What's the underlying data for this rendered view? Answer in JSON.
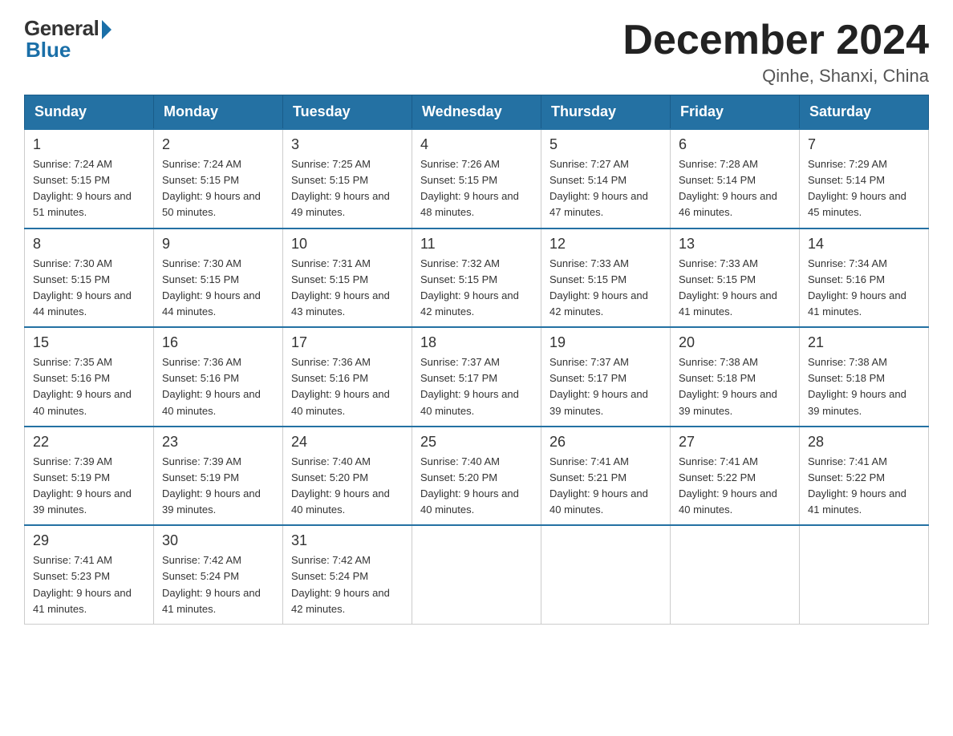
{
  "logo": {
    "general": "General",
    "blue": "Blue"
  },
  "title": "December 2024",
  "location": "Qinhe, Shanxi, China",
  "days_of_week": [
    "Sunday",
    "Monday",
    "Tuesday",
    "Wednesday",
    "Thursday",
    "Friday",
    "Saturday"
  ],
  "weeks": [
    [
      {
        "day": "1",
        "sunrise": "7:24 AM",
        "sunset": "5:15 PM",
        "daylight": "9 hours and 51 minutes."
      },
      {
        "day": "2",
        "sunrise": "7:24 AM",
        "sunset": "5:15 PM",
        "daylight": "9 hours and 50 minutes."
      },
      {
        "day": "3",
        "sunrise": "7:25 AM",
        "sunset": "5:15 PM",
        "daylight": "9 hours and 49 minutes."
      },
      {
        "day": "4",
        "sunrise": "7:26 AM",
        "sunset": "5:15 PM",
        "daylight": "9 hours and 48 minutes."
      },
      {
        "day": "5",
        "sunrise": "7:27 AM",
        "sunset": "5:14 PM",
        "daylight": "9 hours and 47 minutes."
      },
      {
        "day": "6",
        "sunrise": "7:28 AM",
        "sunset": "5:14 PM",
        "daylight": "9 hours and 46 minutes."
      },
      {
        "day": "7",
        "sunrise": "7:29 AM",
        "sunset": "5:14 PM",
        "daylight": "9 hours and 45 minutes."
      }
    ],
    [
      {
        "day": "8",
        "sunrise": "7:30 AM",
        "sunset": "5:15 PM",
        "daylight": "9 hours and 44 minutes."
      },
      {
        "day": "9",
        "sunrise": "7:30 AM",
        "sunset": "5:15 PM",
        "daylight": "9 hours and 44 minutes."
      },
      {
        "day": "10",
        "sunrise": "7:31 AM",
        "sunset": "5:15 PM",
        "daylight": "9 hours and 43 minutes."
      },
      {
        "day": "11",
        "sunrise": "7:32 AM",
        "sunset": "5:15 PM",
        "daylight": "9 hours and 42 minutes."
      },
      {
        "day": "12",
        "sunrise": "7:33 AM",
        "sunset": "5:15 PM",
        "daylight": "9 hours and 42 minutes."
      },
      {
        "day": "13",
        "sunrise": "7:33 AM",
        "sunset": "5:15 PM",
        "daylight": "9 hours and 41 minutes."
      },
      {
        "day": "14",
        "sunrise": "7:34 AM",
        "sunset": "5:16 PM",
        "daylight": "9 hours and 41 minutes."
      }
    ],
    [
      {
        "day": "15",
        "sunrise": "7:35 AM",
        "sunset": "5:16 PM",
        "daylight": "9 hours and 40 minutes."
      },
      {
        "day": "16",
        "sunrise": "7:36 AM",
        "sunset": "5:16 PM",
        "daylight": "9 hours and 40 minutes."
      },
      {
        "day": "17",
        "sunrise": "7:36 AM",
        "sunset": "5:16 PM",
        "daylight": "9 hours and 40 minutes."
      },
      {
        "day": "18",
        "sunrise": "7:37 AM",
        "sunset": "5:17 PM",
        "daylight": "9 hours and 40 minutes."
      },
      {
        "day": "19",
        "sunrise": "7:37 AM",
        "sunset": "5:17 PM",
        "daylight": "9 hours and 39 minutes."
      },
      {
        "day": "20",
        "sunrise": "7:38 AM",
        "sunset": "5:18 PM",
        "daylight": "9 hours and 39 minutes."
      },
      {
        "day": "21",
        "sunrise": "7:38 AM",
        "sunset": "5:18 PM",
        "daylight": "9 hours and 39 minutes."
      }
    ],
    [
      {
        "day": "22",
        "sunrise": "7:39 AM",
        "sunset": "5:19 PM",
        "daylight": "9 hours and 39 minutes."
      },
      {
        "day": "23",
        "sunrise": "7:39 AM",
        "sunset": "5:19 PM",
        "daylight": "9 hours and 39 minutes."
      },
      {
        "day": "24",
        "sunrise": "7:40 AM",
        "sunset": "5:20 PM",
        "daylight": "9 hours and 40 minutes."
      },
      {
        "day": "25",
        "sunrise": "7:40 AM",
        "sunset": "5:20 PM",
        "daylight": "9 hours and 40 minutes."
      },
      {
        "day": "26",
        "sunrise": "7:41 AM",
        "sunset": "5:21 PM",
        "daylight": "9 hours and 40 minutes."
      },
      {
        "day": "27",
        "sunrise": "7:41 AM",
        "sunset": "5:22 PM",
        "daylight": "9 hours and 40 minutes."
      },
      {
        "day": "28",
        "sunrise": "7:41 AM",
        "sunset": "5:22 PM",
        "daylight": "9 hours and 41 minutes."
      }
    ],
    [
      {
        "day": "29",
        "sunrise": "7:41 AM",
        "sunset": "5:23 PM",
        "daylight": "9 hours and 41 minutes."
      },
      {
        "day": "30",
        "sunrise": "7:42 AM",
        "sunset": "5:24 PM",
        "daylight": "9 hours and 41 minutes."
      },
      {
        "day": "31",
        "sunrise": "7:42 AM",
        "sunset": "5:24 PM",
        "daylight": "9 hours and 42 minutes."
      },
      null,
      null,
      null,
      null
    ]
  ]
}
